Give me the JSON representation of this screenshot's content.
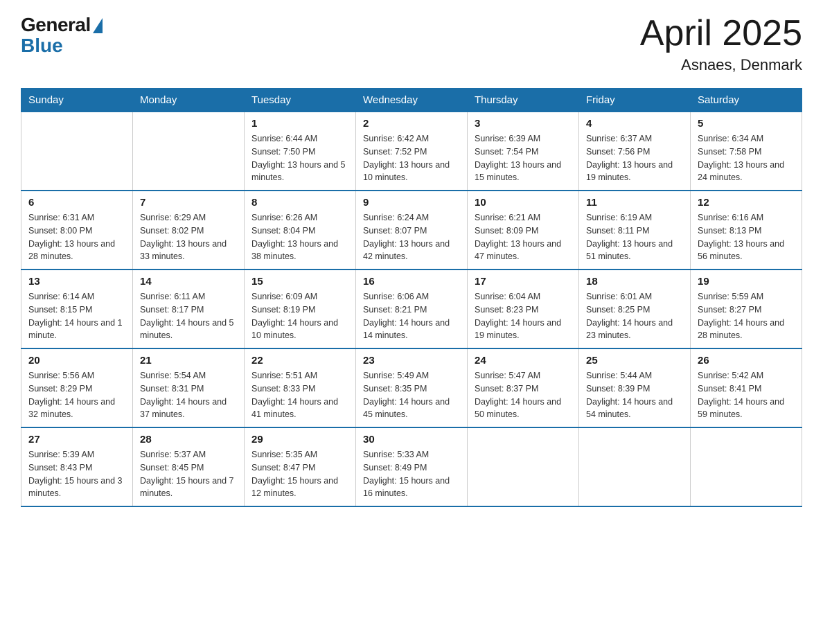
{
  "logo": {
    "general": "General",
    "blue": "Blue"
  },
  "title": "April 2025",
  "location": "Asnaes, Denmark",
  "days_of_week": [
    "Sunday",
    "Monday",
    "Tuesday",
    "Wednesday",
    "Thursday",
    "Friday",
    "Saturday"
  ],
  "weeks": [
    [
      null,
      null,
      {
        "day": "1",
        "sunrise": "6:44 AM",
        "sunset": "7:50 PM",
        "daylight": "13 hours and 5 minutes."
      },
      {
        "day": "2",
        "sunrise": "6:42 AM",
        "sunset": "7:52 PM",
        "daylight": "13 hours and 10 minutes."
      },
      {
        "day": "3",
        "sunrise": "6:39 AM",
        "sunset": "7:54 PM",
        "daylight": "13 hours and 15 minutes."
      },
      {
        "day": "4",
        "sunrise": "6:37 AM",
        "sunset": "7:56 PM",
        "daylight": "13 hours and 19 minutes."
      },
      {
        "day": "5",
        "sunrise": "6:34 AM",
        "sunset": "7:58 PM",
        "daylight": "13 hours and 24 minutes."
      }
    ],
    [
      {
        "day": "6",
        "sunrise": "6:31 AM",
        "sunset": "8:00 PM",
        "daylight": "13 hours and 28 minutes."
      },
      {
        "day": "7",
        "sunrise": "6:29 AM",
        "sunset": "8:02 PM",
        "daylight": "13 hours and 33 minutes."
      },
      {
        "day": "8",
        "sunrise": "6:26 AM",
        "sunset": "8:04 PM",
        "daylight": "13 hours and 38 minutes."
      },
      {
        "day": "9",
        "sunrise": "6:24 AM",
        "sunset": "8:07 PM",
        "daylight": "13 hours and 42 minutes."
      },
      {
        "day": "10",
        "sunrise": "6:21 AM",
        "sunset": "8:09 PM",
        "daylight": "13 hours and 47 minutes."
      },
      {
        "day": "11",
        "sunrise": "6:19 AM",
        "sunset": "8:11 PM",
        "daylight": "13 hours and 51 minutes."
      },
      {
        "day": "12",
        "sunrise": "6:16 AM",
        "sunset": "8:13 PM",
        "daylight": "13 hours and 56 minutes."
      }
    ],
    [
      {
        "day": "13",
        "sunrise": "6:14 AM",
        "sunset": "8:15 PM",
        "daylight": "14 hours and 1 minute."
      },
      {
        "day": "14",
        "sunrise": "6:11 AM",
        "sunset": "8:17 PM",
        "daylight": "14 hours and 5 minutes."
      },
      {
        "day": "15",
        "sunrise": "6:09 AM",
        "sunset": "8:19 PM",
        "daylight": "14 hours and 10 minutes."
      },
      {
        "day": "16",
        "sunrise": "6:06 AM",
        "sunset": "8:21 PM",
        "daylight": "14 hours and 14 minutes."
      },
      {
        "day": "17",
        "sunrise": "6:04 AM",
        "sunset": "8:23 PM",
        "daylight": "14 hours and 19 minutes."
      },
      {
        "day": "18",
        "sunrise": "6:01 AM",
        "sunset": "8:25 PM",
        "daylight": "14 hours and 23 minutes."
      },
      {
        "day": "19",
        "sunrise": "5:59 AM",
        "sunset": "8:27 PM",
        "daylight": "14 hours and 28 minutes."
      }
    ],
    [
      {
        "day": "20",
        "sunrise": "5:56 AM",
        "sunset": "8:29 PM",
        "daylight": "14 hours and 32 minutes."
      },
      {
        "day": "21",
        "sunrise": "5:54 AM",
        "sunset": "8:31 PM",
        "daylight": "14 hours and 37 minutes."
      },
      {
        "day": "22",
        "sunrise": "5:51 AM",
        "sunset": "8:33 PM",
        "daylight": "14 hours and 41 minutes."
      },
      {
        "day": "23",
        "sunrise": "5:49 AM",
        "sunset": "8:35 PM",
        "daylight": "14 hours and 45 minutes."
      },
      {
        "day": "24",
        "sunrise": "5:47 AM",
        "sunset": "8:37 PM",
        "daylight": "14 hours and 50 minutes."
      },
      {
        "day": "25",
        "sunrise": "5:44 AM",
        "sunset": "8:39 PM",
        "daylight": "14 hours and 54 minutes."
      },
      {
        "day": "26",
        "sunrise": "5:42 AM",
        "sunset": "8:41 PM",
        "daylight": "14 hours and 59 minutes."
      }
    ],
    [
      {
        "day": "27",
        "sunrise": "5:39 AM",
        "sunset": "8:43 PM",
        "daylight": "15 hours and 3 minutes."
      },
      {
        "day": "28",
        "sunrise": "5:37 AM",
        "sunset": "8:45 PM",
        "daylight": "15 hours and 7 minutes."
      },
      {
        "day": "29",
        "sunrise": "5:35 AM",
        "sunset": "8:47 PM",
        "daylight": "15 hours and 12 minutes."
      },
      {
        "day": "30",
        "sunrise": "5:33 AM",
        "sunset": "8:49 PM",
        "daylight": "15 hours and 16 minutes."
      },
      null,
      null,
      null
    ]
  ]
}
